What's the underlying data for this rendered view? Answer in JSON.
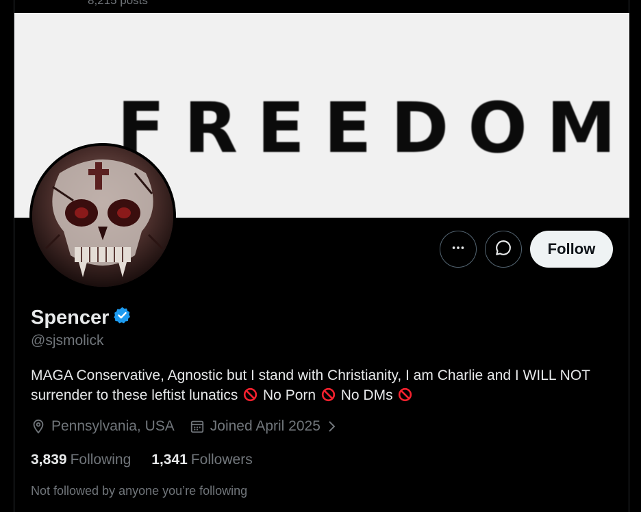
{
  "header": {
    "post_count": "8,215 posts"
  },
  "banner": {
    "text": "FREEDOM"
  },
  "actions": {
    "follow_label": "Follow"
  },
  "profile": {
    "display_name": "Spencer",
    "handle": "@sjsmolick",
    "bio_part1": "MAGA Conservative, Agnostic but I stand with Christianity, I am Charlie and I WILL NOT surrender to these leftist lunatics",
    "bio_part2": "No Porn",
    "bio_part3": "No DMs",
    "location": "Pennsylvania, USA",
    "joined": "Joined April 2025",
    "following_count": "3,839",
    "following_label": "Following",
    "followers_count": "1,341",
    "followers_label": "Followers",
    "not_followed_text": "Not followed by anyone you’re following"
  },
  "colors": {
    "verified": "#1d9bf0",
    "prohibited": "#f4212e",
    "muted_text": "#71767b"
  },
  "icons": [
    "more-icon",
    "message-icon",
    "verified-badge-icon",
    "location-icon",
    "calendar-icon",
    "chevron-right-icon",
    "prohibited-icon"
  ]
}
